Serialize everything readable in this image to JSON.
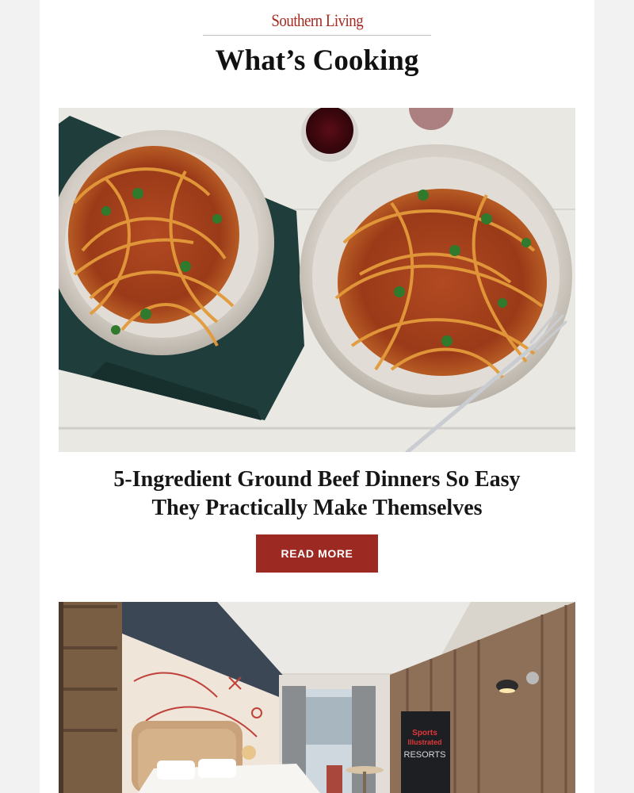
{
  "brand": {
    "logo_text": "Southern Living",
    "accent_color": "#9c2a23"
  },
  "section": {
    "title": "What’s Cooking"
  },
  "article": {
    "image_icon": "spaghetti-bolognese-photo",
    "headline_line1": "5-Ingredient Ground Beef Dinners So Easy",
    "headline_line2": "They Practically Make Themselves",
    "cta_label": "READ MORE"
  },
  "next_article": {
    "image_icon": "hotel-room-photo",
    "sign_line1": "Sports",
    "sign_line2": "Illustrated",
    "sign_line3": "RESORTS"
  }
}
